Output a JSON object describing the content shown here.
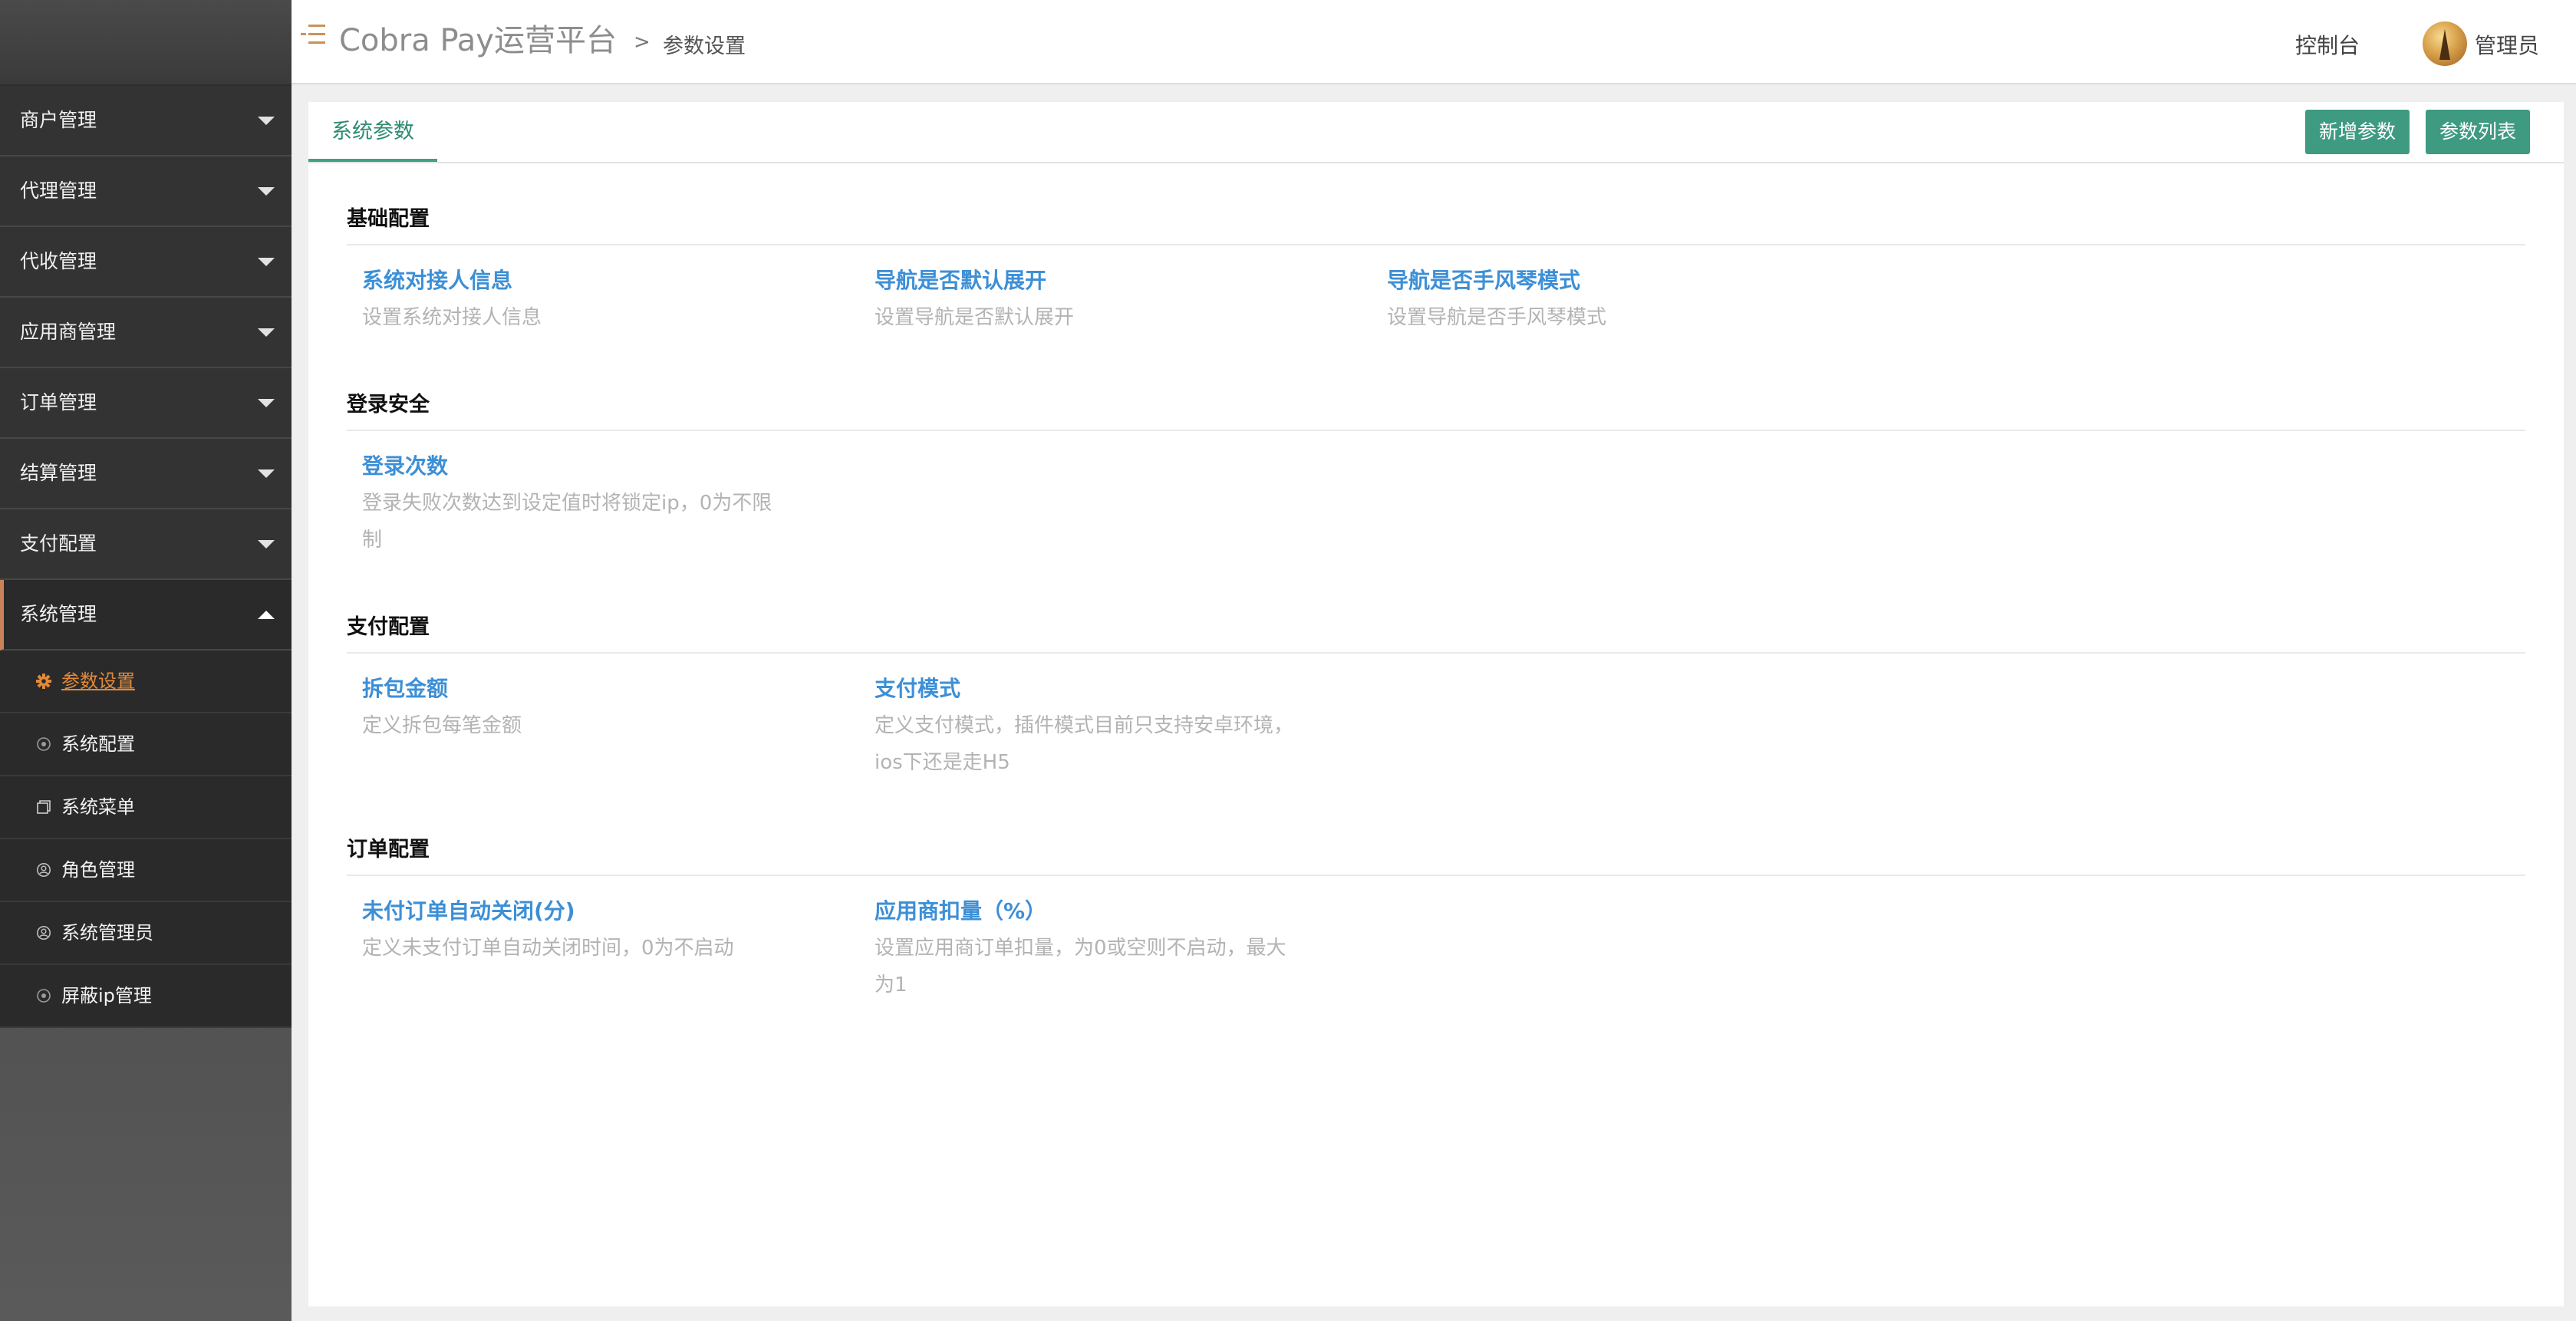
{
  "header": {
    "app_title": "Cobra Pay运营平台",
    "breadcrumb_separator": ">",
    "breadcrumb_current": "参数设置",
    "console_label": "控制台",
    "user_name": "管理员"
  },
  "sidebar": {
    "groups": [
      {
        "label": "商户管理"
      },
      {
        "label": "代理管理"
      },
      {
        "label": "代收管理"
      },
      {
        "label": "应用商管理"
      },
      {
        "label": "订单管理"
      },
      {
        "label": "结算管理"
      },
      {
        "label": "支付配置"
      },
      {
        "label": "系统管理"
      }
    ],
    "sub_items": [
      {
        "label": "参数设置",
        "icon": "gear-icon"
      },
      {
        "label": "系统配置",
        "icon": "circle-dot-icon"
      },
      {
        "label": "系统菜单",
        "icon": "window-icon"
      },
      {
        "label": "角色管理",
        "icon": "user-circle-icon"
      },
      {
        "label": "系统管理员",
        "icon": "user-circle-icon"
      },
      {
        "label": "屏蔽ip管理",
        "icon": "circle-dot-icon"
      }
    ]
  },
  "tabs": {
    "active": "系统参数",
    "add_button": "新增参数",
    "list_button": "参数列表"
  },
  "sections": [
    {
      "title": "基础配置",
      "items": [
        {
          "title": "系统对接人信息",
          "desc": "设置系统对接人信息"
        },
        {
          "title": "导航是否默认展开",
          "desc": "设置导航是否默认展开"
        },
        {
          "title": "导航是否手风琴模式",
          "desc": "设置导航是否手风琴模式"
        }
      ]
    },
    {
      "title": "登录安全",
      "items": [
        {
          "title": "登录次数",
          "desc": "登录失败次数达到设定值时将锁定ip，0为不限制"
        }
      ]
    },
    {
      "title": "支付配置",
      "items": [
        {
          "title": "拆包金额",
          "desc": "定义拆包每笔金额"
        },
        {
          "title": "支付模式",
          "desc": "定义支付模式，插件模式目前只支持安卓环境，ios下还是走H5"
        }
      ]
    },
    {
      "title": "订单配置",
      "items": [
        {
          "title": "未付订单自动关闭(分)",
          "desc": "定义未支付订单自动关闭时间，0为不启动"
        },
        {
          "title": "应用商扣量（%）",
          "desc": "设置应用商订单扣量，为0或空则不启动，最大为1"
        }
      ]
    }
  ],
  "colors": {
    "accent_green": "#3f9a82",
    "link_blue": "#3d8fd6",
    "active_orange": "#e08a3a"
  }
}
